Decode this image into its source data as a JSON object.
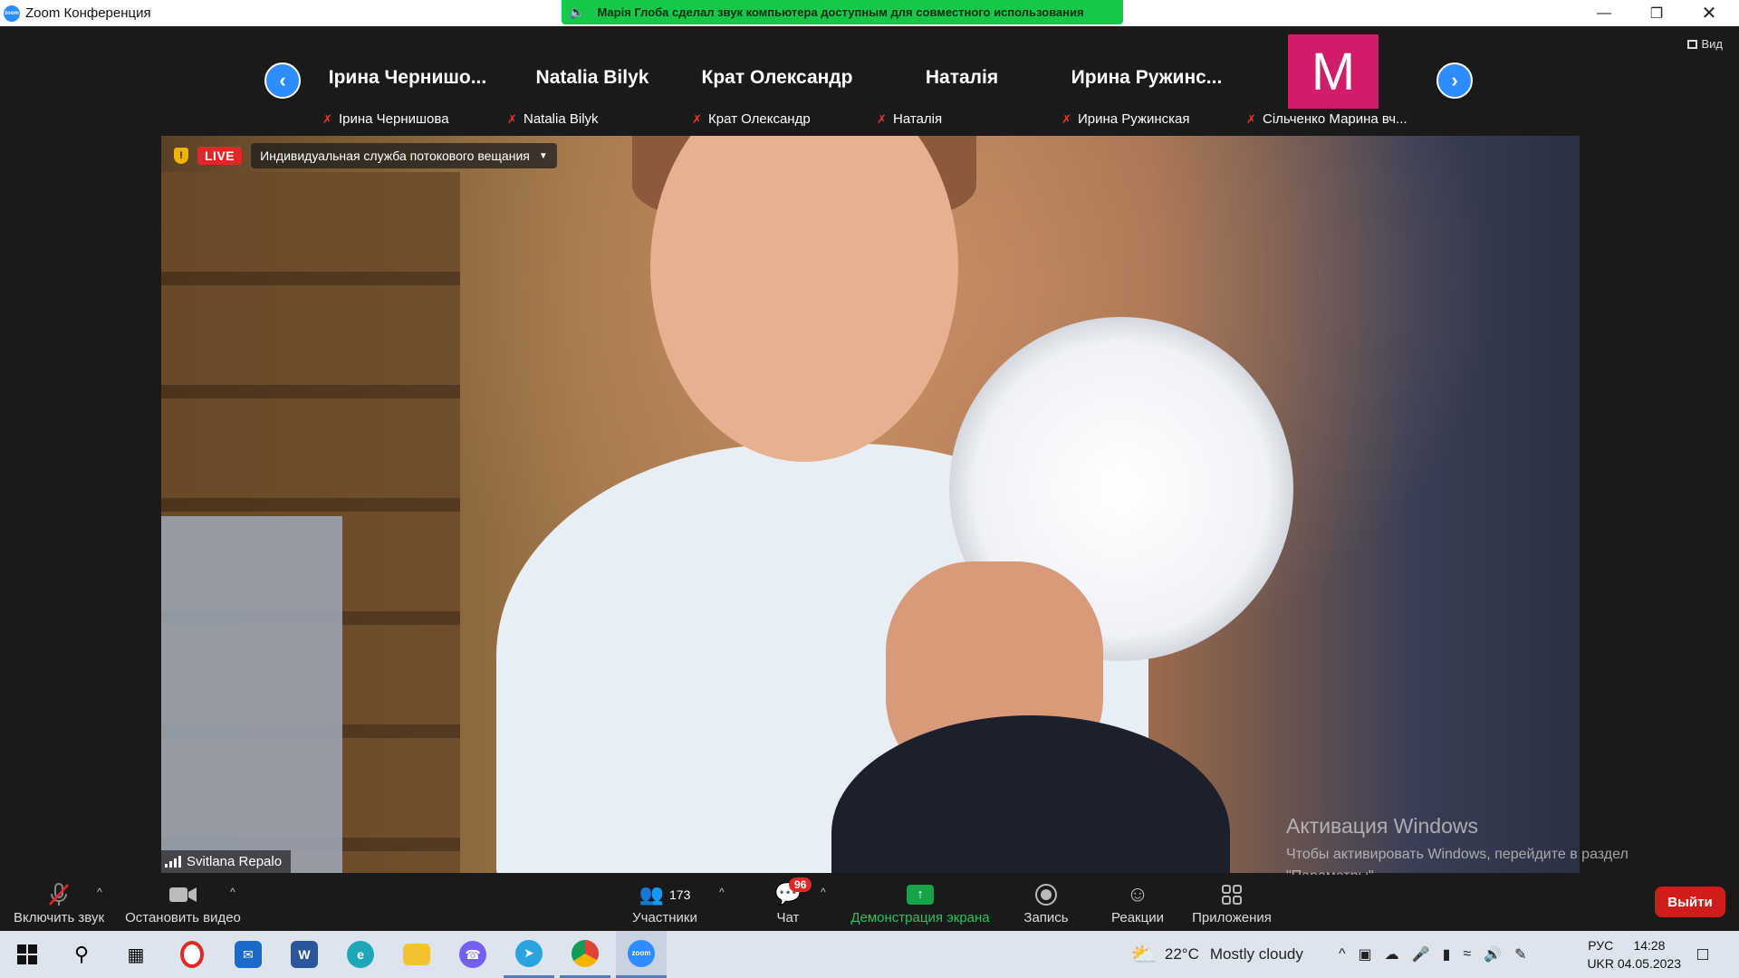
{
  "window": {
    "title": "Zoom Конференция",
    "notice": "Марія Глоба сделал звук компьютера доступным для совместного использования"
  },
  "header": {
    "view_label": "Вид"
  },
  "participants": [
    {
      "display": "Ірина Чернишо...",
      "name": "Ірина Чернишова",
      "muted": true
    },
    {
      "display": "Natalia Bilyk",
      "name": "Natalia Bilyk",
      "muted": true
    },
    {
      "display": "Крат Олександр",
      "name": "Крат Олександр",
      "muted": true
    },
    {
      "display": "Наталія",
      "name": "Наталія",
      "muted": true
    },
    {
      "display": "Ирина Ружинс...",
      "name": "Ирина Ружинская",
      "muted": true
    },
    {
      "avatar_letter": "M",
      "avatar_color": "#d11c6a",
      "name": "Сільченко Марина вч...",
      "muted": true
    }
  ],
  "stream": {
    "live_label": "LIVE",
    "service": "Индивидуальная служба потокового вещания"
  },
  "active_speaker": "Svitlana Repalo",
  "activation": {
    "heading": "Активация Windows",
    "text": "Чтобы активировать Windows, перейдите в раздел \"Параметры\"."
  },
  "toolbar": {
    "unmute": "Включить звук",
    "stop_video": "Остановить видео",
    "participants": "Участники",
    "participants_count": "173",
    "chat": "Чат",
    "chat_badge": "96",
    "share": "Демонстрация экрана",
    "record": "Запись",
    "reactions": "Реакции",
    "apps": "Приложения",
    "leave": "Выйти"
  },
  "taskbar": {
    "weather_temp": "22°C",
    "weather_text": "Mostly cloudy",
    "lang_top": "РУС",
    "lang_bottom": "UKR",
    "time": "14:28",
    "date": "04.05.2023"
  },
  "colors": {
    "accent": "#2d8cff",
    "live": "#e02828",
    "share_green": "#16a34a",
    "leave_red": "#d11c1c"
  }
}
